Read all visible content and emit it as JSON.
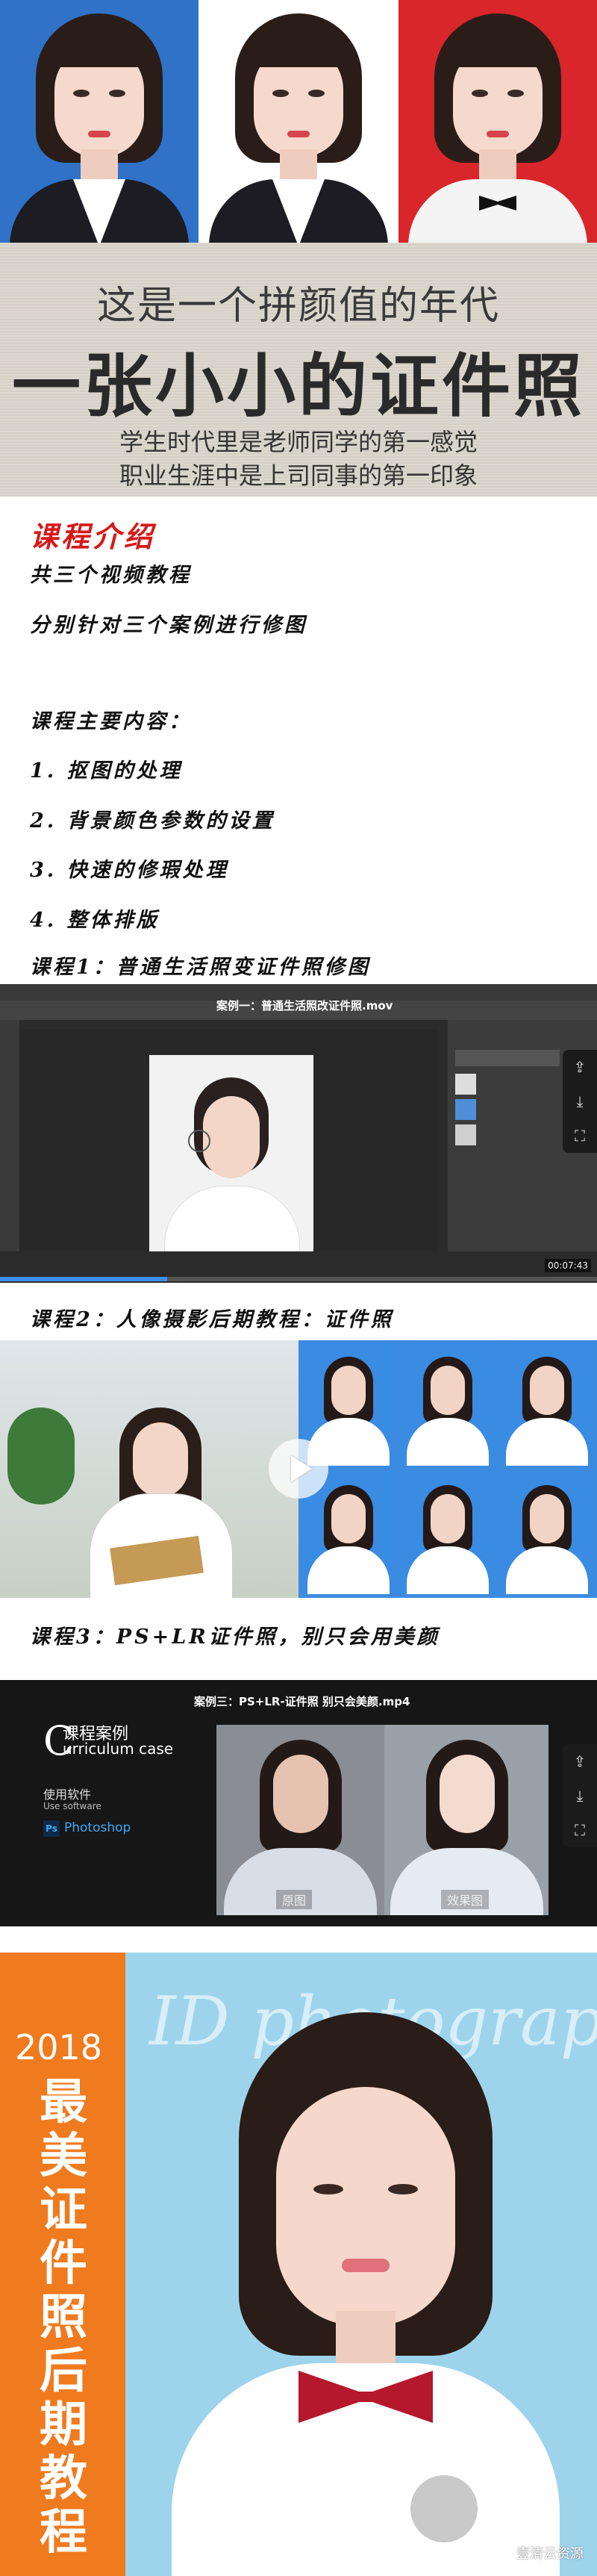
{
  "portraits": [
    {
      "bg": "#2f72c8",
      "outfit": "suit"
    },
    {
      "bg": "#ffffff",
      "outfit": "suit"
    },
    {
      "bg": "#d8262a",
      "outfit": "shirt-bow"
    }
  ],
  "headline": {
    "line1": "这是一个拼颜值的年代",
    "line2": "一张小小的证件照",
    "line3": "学生时代里是老师同学的第一感觉",
    "line4": "职业生涯中是上司同事的第一印象"
  },
  "intro": {
    "title": "课程介绍",
    "line1": "共三个视频教程",
    "line2": "分别针对三个案例进行修图",
    "content_heading": "课程主要内容：",
    "items": [
      "1. 抠图的处理",
      "2. 背景颜色参数的设置",
      "3. 快速的修瑕处理",
      "4. 整体排版"
    ]
  },
  "course1": {
    "heading": "课程1：普通生活照变证件照修图",
    "video_title": "案例一：普通生活照改证件照.mov",
    "time": "00:07:43",
    "progress": 0.28
  },
  "course2": {
    "heading": "课程2：人像摄影后期教程：证件照"
  },
  "course3": {
    "heading": "课程3：PS+LR证件照，别只会用美颜",
    "video_title": "案例三：PS+LR-证件照 别只会美颜.mp4",
    "case_cn": "课程案例",
    "case_en": "urriculum case",
    "case_letter": "C",
    "software_cn": "使用软件",
    "software_en": "Use software",
    "ps_icon": "Ps",
    "ps_name": "Photoshop",
    "label_before": "原图",
    "label_after": "效果图"
  },
  "poster": {
    "year": "2018",
    "vertical_title": [
      "最",
      "美",
      "证",
      "件",
      "照",
      "后",
      "期",
      "教",
      "程"
    ],
    "script_text": "ID photograph",
    "watermark": "壹清云资源"
  },
  "icons": {
    "share": "share-icon",
    "download": "download-icon",
    "fullscreen": "fullscreen-icon",
    "play": "play-icon"
  },
  "colors": {
    "intro_title": "#d81818",
    "poster_orange": "#f07a1e",
    "poster_blue": "#9dd4ec",
    "bow_red": "#b5182c"
  }
}
